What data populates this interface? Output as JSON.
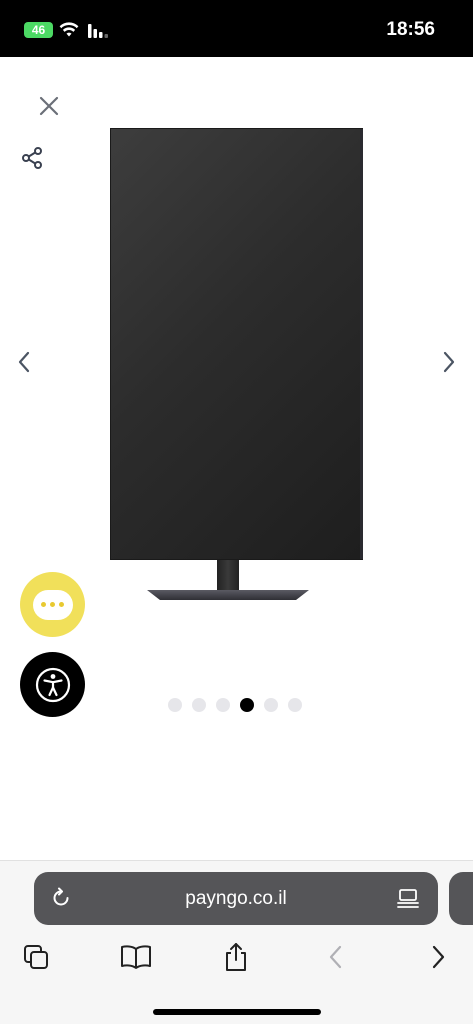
{
  "status_bar": {
    "battery_level": "46",
    "time": "18:56"
  },
  "viewer": {
    "total_images": 6,
    "active_image_index": 3
  },
  "browser": {
    "url": "payngo.co.il"
  },
  "colors": {
    "chat_button": "#f1e05a",
    "accessibility_button": "#000000",
    "url_pill": "#555558",
    "battery": "#4cd964",
    "active_dot": "#000000",
    "inactive_dot": "#e6e6ea"
  }
}
